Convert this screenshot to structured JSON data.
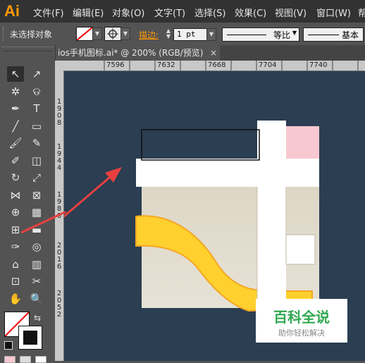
{
  "app": {
    "logo": "Ai"
  },
  "menu": [
    "文件(F)",
    "编辑(E)",
    "对象(O)",
    "文字(T)",
    "选择(S)",
    "效果(C)",
    "视图(V)",
    "窗口(W)",
    "帮"
  ],
  "control": {
    "selection_status": "未选择对象",
    "stroke_label": "描边:",
    "stroke_weight": "1 pt",
    "stroke_profile": "等比",
    "brush_definition": "基本"
  },
  "document": {
    "tab_title": "ios手机图标.ai* @ 200% (RGB/预览)",
    "close": "×"
  },
  "ruler": {
    "top": [
      "7596",
      "7632",
      "7668",
      "7704",
      "7740"
    ],
    "left_1": [
      "1",
      "9",
      "0",
      "8"
    ],
    "left_2": [
      "1",
      "9",
      "4",
      "4"
    ],
    "left_3": [
      "1",
      "9",
      "8",
      "0"
    ],
    "left_4": [
      "2",
      "0",
      "1",
      "6"
    ],
    "left_5": [
      "2",
      "0",
      "5",
      "2"
    ]
  },
  "watermark": {
    "title": "百科全说",
    "subtitle": "助你轻松解决"
  },
  "colors": {
    "canvas": "#2b3e52",
    "artboard": "#ddd6c5",
    "accent_yellow": "#ffd02e",
    "pink": "#f7c8d0",
    "arrow_red": "#e84040",
    "app_orange": "#ff9a00"
  },
  "tools": [
    {
      "name": "selection-tool",
      "glyph": "↖"
    },
    {
      "name": "direct-selection-tool",
      "glyph": "↗"
    },
    {
      "name": "magic-wand-tool",
      "glyph": "✲"
    },
    {
      "name": "lasso-tool",
      "glyph": "ଡ"
    },
    {
      "name": "pen-tool",
      "glyph": "✒"
    },
    {
      "name": "type-tool",
      "glyph": "T"
    },
    {
      "name": "line-tool",
      "glyph": "╱"
    },
    {
      "name": "rectangle-tool",
      "glyph": "▭"
    },
    {
      "name": "paintbrush-tool",
      "glyph": "🖌"
    },
    {
      "name": "pencil-tool",
      "glyph": "✎"
    },
    {
      "name": "blob-brush-tool",
      "glyph": "✐"
    },
    {
      "name": "eraser-tool",
      "glyph": "◫"
    },
    {
      "name": "rotate-tool",
      "glyph": "↻"
    },
    {
      "name": "scale-tool",
      "glyph": "⤢"
    },
    {
      "name": "width-tool",
      "glyph": "⋈"
    },
    {
      "name": "free-transform-tool",
      "glyph": "⊠"
    },
    {
      "name": "shape-builder-tool",
      "glyph": "⊕"
    },
    {
      "name": "perspective-grid-tool",
      "glyph": "▦"
    },
    {
      "name": "mesh-tool",
      "glyph": "⊞"
    },
    {
      "name": "gradient-tool",
      "glyph": "▬"
    },
    {
      "name": "eyedropper-tool",
      "glyph": "✑"
    },
    {
      "name": "blend-tool",
      "glyph": "◎"
    },
    {
      "name": "symbol-sprayer-tool",
      "glyph": "⌂"
    },
    {
      "name": "column-graph-tool",
      "glyph": "▥"
    },
    {
      "name": "artboard-tool",
      "glyph": "⊡"
    },
    {
      "name": "slice-tool",
      "glyph": "✂"
    },
    {
      "name": "hand-tool",
      "glyph": "✋"
    },
    {
      "name": "zoom-tool",
      "glyph": "🔍"
    }
  ]
}
